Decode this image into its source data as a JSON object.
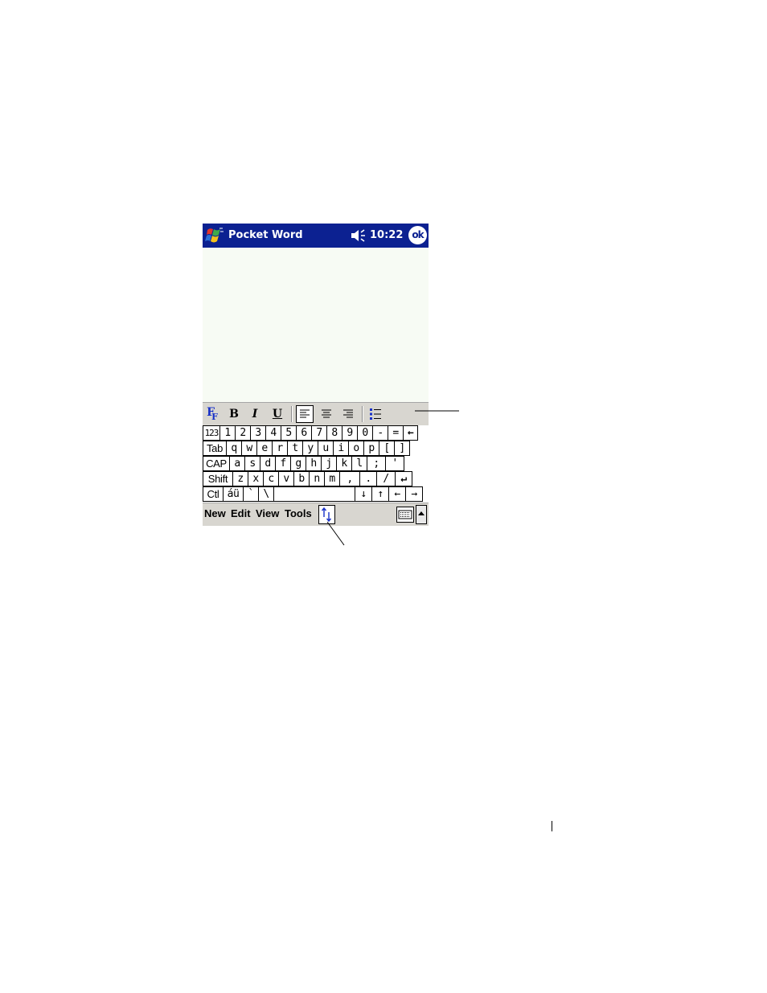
{
  "titlebar": {
    "app_title": "Pocket Word",
    "time": "10:22",
    "ok_label": "ok"
  },
  "format_toolbar": {
    "font_label": "F",
    "bold_label": "B",
    "italic_label": "I",
    "underline_label": "U"
  },
  "keyboard": {
    "rows": [
      [
        "123",
        "1",
        "2",
        "3",
        "4",
        "5",
        "6",
        "7",
        "8",
        "9",
        "0",
        "-",
        "=",
        "←"
      ],
      [
        "Tab",
        "q",
        "w",
        "e",
        "r",
        "t",
        "y",
        "u",
        "i",
        "o",
        "p",
        "[",
        "]"
      ],
      [
        "CAP",
        "a",
        "s",
        "d",
        "f",
        "g",
        "h",
        "j",
        "k",
        "l",
        ";",
        "'"
      ],
      [
        "Shift",
        "z",
        "x",
        "c",
        "v",
        "b",
        "n",
        "m",
        ",",
        ".",
        "/",
        "↵"
      ],
      [
        "Ctl",
        "áü",
        "`",
        "\\",
        " ",
        "↓",
        "↑",
        "←",
        "→"
      ]
    ]
  },
  "menubar": {
    "items": [
      "New",
      "Edit",
      "View",
      "Tools"
    ]
  },
  "colors": {
    "titlebar": "#0c2191",
    "toolbar": "#d8d6d0",
    "document": "#f7fbf4"
  }
}
